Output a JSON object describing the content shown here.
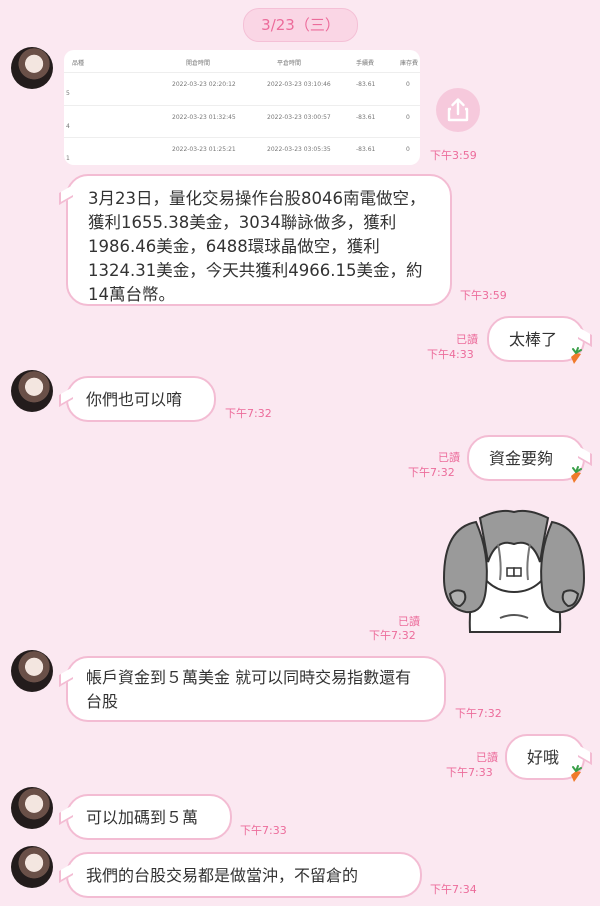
{
  "date_chip": "3/23（三）",
  "screenshot_table": {
    "headers": [
      "品種",
      "開倉時間",
      "平倉時間",
      "手續費",
      "庫存費"
    ],
    "rows": [
      {
        "idx": "5",
        "open": "2022-03-23 02:20:12",
        "close": "2022-03-23 03:10:46",
        "fee": "-83.61",
        "stock": "0"
      },
      {
        "idx": "4",
        "open": "2022-03-23 01:32:45",
        "close": "2022-03-23 03:00:57",
        "fee": "-83.61",
        "stock": "0"
      },
      {
        "idx": "1",
        "open": "2022-03-23 01:25:21",
        "close": "2022-03-23 03:05:35",
        "fee": "-83.61",
        "stock": "0"
      }
    ]
  },
  "messages": {
    "m1_time": "下午3:59",
    "m2_text": "3月23日，量化交易操作台股8046南電做空，獲利1655.38美金，3034聯詠做多，獲利1986.46美金，6488環球晶做空，獲利1324.31美金，今天共獲利4966.15美金，約14萬台幣。",
    "m2_time": "下午3:59",
    "m3_text": "太棒了",
    "m3_read": "已讀",
    "m3_time": "下午4:33",
    "m4_text": "你們也可以唷",
    "m4_time": "下午7:32",
    "m5_text": "資金要夠",
    "m5_read": "已讀",
    "m5_time": "下午7:32",
    "m6_read": "已讀",
    "m6_time": "下午7:32",
    "m7_text": "帳戶資金到５萬美金 就可以同時交易指數還有台股",
    "m7_time": "下午7:32",
    "m8_text": "好哦",
    "m8_read": "已讀",
    "m8_time": "下午7:33",
    "m9_text": "可以加碼到５萬",
    "m9_time": "下午7:33",
    "m10_text": "我們的台股交易都是做當沖，不留倉的",
    "m10_time": "下午7:34"
  },
  "icons": [
    "share-icon",
    "carrot-icon",
    "rabbit-sticker"
  ],
  "colors": {
    "background": "#fbe8f1",
    "accent": "#ec6c9b",
    "bubble_border": "#f3bcd3"
  }
}
